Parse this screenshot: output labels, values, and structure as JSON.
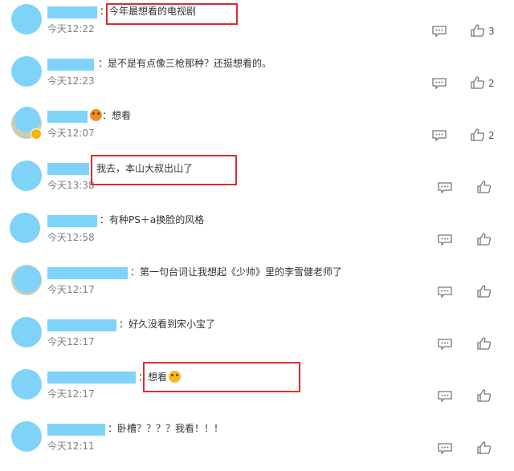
{
  "comments": [
    {
      "text": "：今年最想看的电视剧",
      "time": "今天12:22",
      "likes": "3"
    },
    {
      "text": "：是不是有点像三枪那种？还挺想看的。",
      "time": "今天12:23",
      "likes": "2"
    },
    {
      "text": "：想看",
      "time": "今天12:07",
      "likes": "2"
    },
    {
      "text": "我去，本山大叔出山了",
      "time": "今天13:38",
      "likes": ""
    },
    {
      "text": "：有种PS＋a换脸的风格",
      "time": "今天12:58",
      "likes": ""
    },
    {
      "text": "：第一句台词让我想起《少帅》里的李雪健老师了",
      "time": "今天12:17",
      "likes": ""
    },
    {
      "text": "：好久没看到宋小宝了",
      "time": "今天12:17",
      "likes": ""
    },
    {
      "text": "：想看",
      "time": "今天12:17",
      "likes": ""
    },
    {
      "text": "：卧槽？？？？我看！！！",
      "time": "今天12:11",
      "likes": ""
    }
  ],
  "colors": {
    "highlight": "#e02b2b",
    "avatar_mask": "#7fd3f9"
  },
  "icons": {
    "reply": "comment-bubble-icon",
    "like": "thumbs-up-icon"
  }
}
